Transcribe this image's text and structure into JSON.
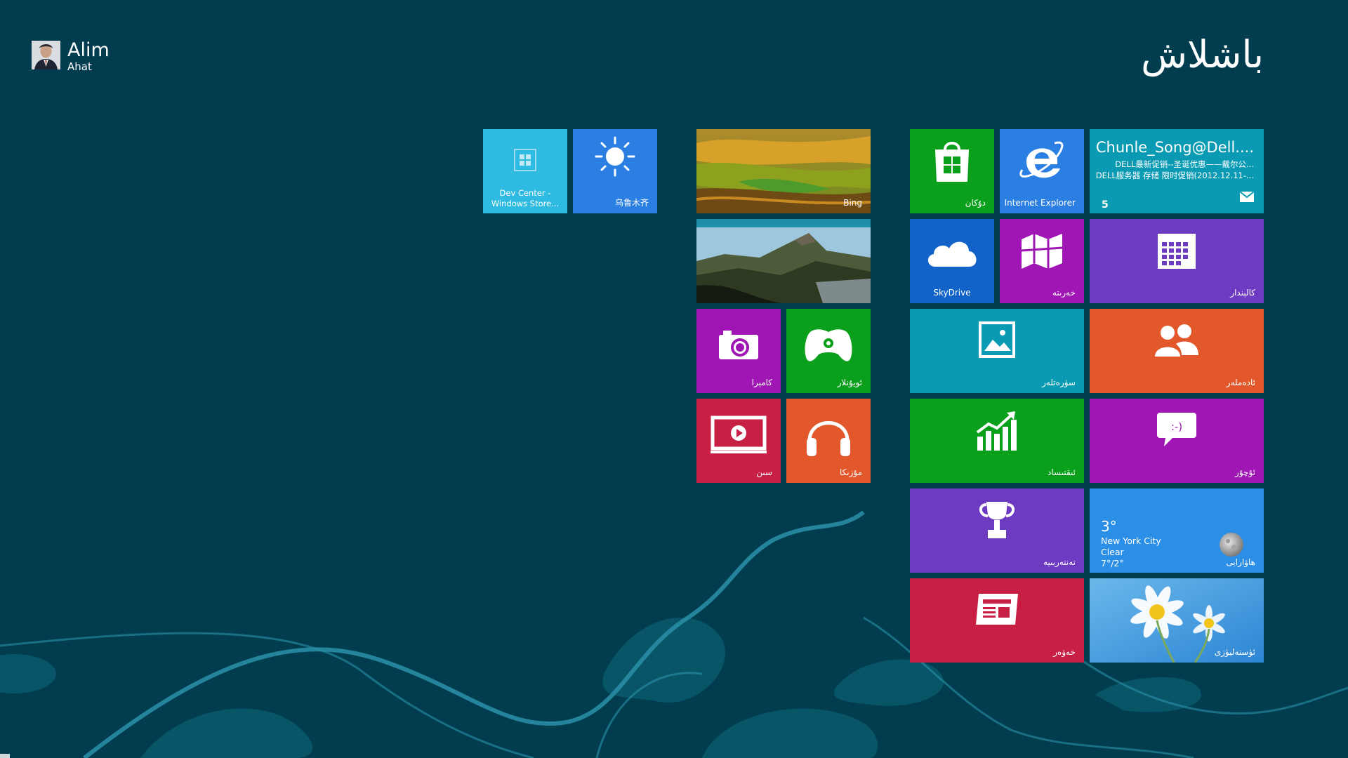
{
  "user": {
    "first_name": "Alim",
    "last_name": "Ahat"
  },
  "start_title": "باشلاش",
  "tiles": {
    "dev_center": {
      "label": "Dev Center -\nWindows Store...",
      "label_line1": "Dev Center -",
      "label_line2": "Windows Store...",
      "icon": "windows-logo-icon"
    },
    "urumqi": {
      "label": "乌鲁木齐",
      "icon": "sun-icon"
    },
    "bing": {
      "label": "Bing"
    },
    "store": {
      "label": "دۇكان",
      "icon": "shopping-bag-icon"
    },
    "ie": {
      "label": "Internet Explorer",
      "icon": "internet-explorer-icon"
    },
    "mail": {
      "sender": "Chunle_Song@Dell....",
      "line1": "DELL最新促销--圣诞优惠——戴尔公...",
      "line2": "DELL服务器 存储 限时促销(2012.12.11-...",
      "count": "5",
      "icon": "envelope-icon"
    },
    "skydrive": {
      "label": "SkyDrive",
      "icon": "cloud-icon"
    },
    "maps": {
      "label": "خەرىتە",
      "icon": "map-icon"
    },
    "calendar": {
      "label": "كالېندار",
      "icon": "calendar-icon"
    },
    "camera": {
      "label": "كامېرا",
      "icon": "camera-icon"
    },
    "games": {
      "label": "ئويۇنلار",
      "icon": "gamepad-icon"
    },
    "photos": {
      "label": "سۈرەتلەر",
      "icon": "picture-icon"
    },
    "people": {
      "label": "ئادەملەر",
      "icon": "people-icon"
    },
    "video": {
      "label": "سىن",
      "icon": "video-icon"
    },
    "music": {
      "label": "مۇزىكا",
      "icon": "headphones-icon"
    },
    "finance": {
      "label": "ئىقتىساد",
      "icon": "chart-icon"
    },
    "messaging": {
      "label": "ئۇچۇر",
      "icon": "chat-icon"
    },
    "sports": {
      "label": "تەنتەربىيە",
      "icon": "trophy-icon"
    },
    "weather": {
      "temp": "3°",
      "city": "New York City",
      "condition": "Clear",
      "range": "7°/2°",
      "label": "ھاۋارايى",
      "icon": "moon-icon"
    },
    "news": {
      "label": "خەۋەر",
      "icon": "newspaper-icon"
    },
    "desktop": {
      "label": "ئۈستەليۈزى"
    }
  },
  "colors": {
    "background": "#013d4f",
    "cyan": "#2fbbe1",
    "blue": "#2b7fe3",
    "green": "#0aa01b",
    "teal": "#0a9ab3",
    "purple": "#a016b5",
    "violet": "#6d3ac2",
    "orange": "#e2582b",
    "crimson": "#c81f45",
    "skydrive_blue": "#1162c9"
  }
}
